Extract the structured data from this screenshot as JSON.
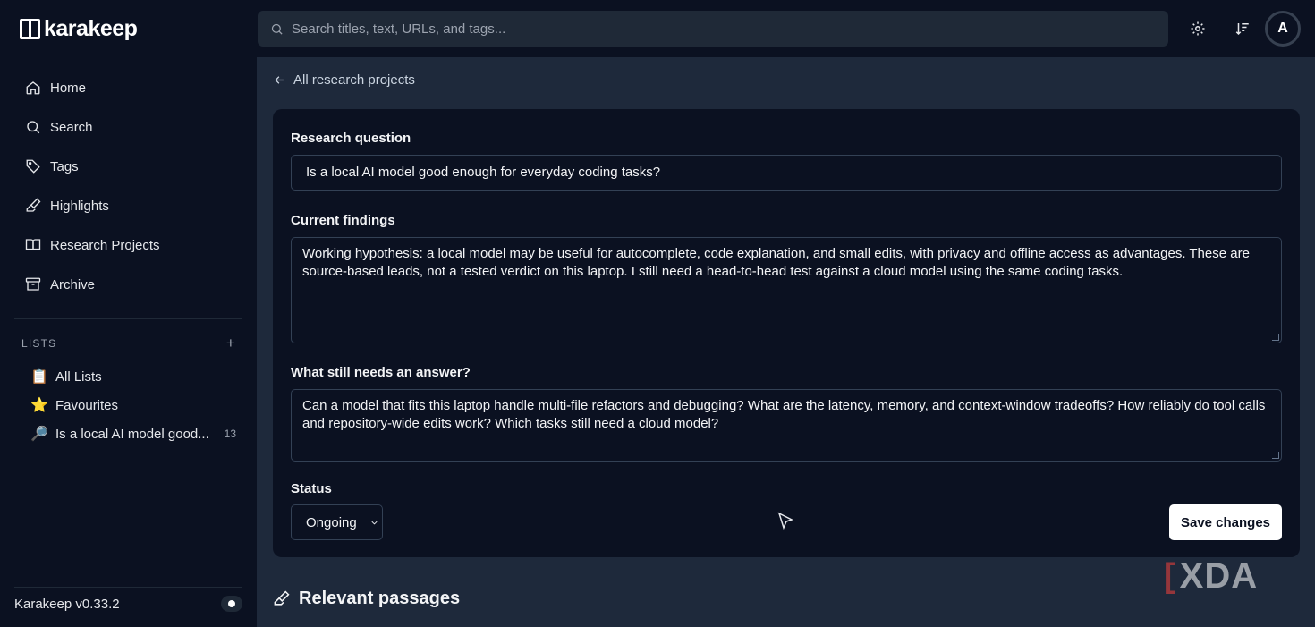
{
  "app": {
    "name": "karakeep",
    "version": "Karakeep v0.33.2"
  },
  "sidebar": {
    "items": [
      {
        "label": "Home",
        "icon": "home-icon"
      },
      {
        "label": "Search",
        "icon": "search-icon"
      },
      {
        "label": "Tags",
        "icon": "tag-icon"
      },
      {
        "label": "Highlights",
        "icon": "highlighter-icon"
      },
      {
        "label": "Research Projects",
        "icon": "book-open-icon"
      },
      {
        "label": "Archive",
        "icon": "archive-icon"
      }
    ],
    "lists_heading": "LISTS",
    "lists_add": "+",
    "lists": [
      {
        "emoji": "📋",
        "label": "All Lists",
        "count": ""
      },
      {
        "emoji": "⭐",
        "label": "Favourites",
        "count": ""
      },
      {
        "emoji": "🔎",
        "label": "Is a local AI model good...",
        "count": "13"
      }
    ]
  },
  "topbar": {
    "search_placeholder": "Search titles, text, URLs, and tags...",
    "avatar_initial": "A"
  },
  "main": {
    "back_link": "All research projects",
    "research_question_label": "Research question",
    "research_question_value": "Is a local AI model good enough for everyday coding tasks?",
    "findings_label": "Current findings",
    "findings_value": "Working hypothesis: a local model may be useful for autocomplete, code explanation, and small edits, with privacy and offline access as advantages. These are source-based leads, not a tested verdict on this laptop. I still need a head-to-head test against a cloud model using the same coding tasks.",
    "open_questions_label": "What still needs an answer?",
    "open_questions_value": "Can a model that fits this laptop handle multi-file refactors and debugging? What are the latency, memory, and context-window tradeoffs? How reliably do tool calls and repository-wide edits work? Which tasks still need a cloud model?",
    "status_label": "Status",
    "status_value": "Ongoing",
    "save_label": "Save changes",
    "passages_heading": "Relevant passages"
  },
  "watermark": "XDA",
  "colors": {
    "background": "#0b1121",
    "main_bg": "#1e293b",
    "border": "#334155"
  }
}
